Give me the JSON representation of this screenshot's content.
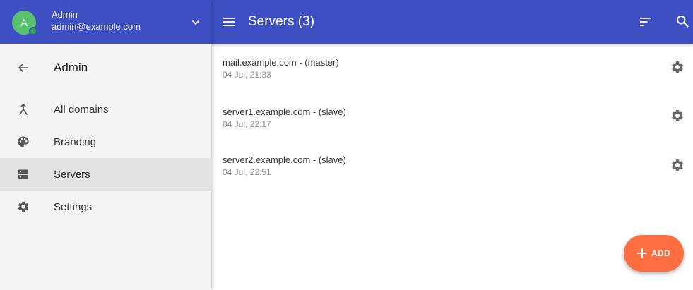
{
  "account": {
    "initial": "A",
    "name": "Admin",
    "email": "admin@example.com",
    "toggle_icon": "chevron-down-icon"
  },
  "nav": {
    "back": {
      "icon": "arrow-back-icon",
      "label": "Admin"
    },
    "items": [
      {
        "icon": "merge-icon",
        "label": "All domains",
        "active": false
      },
      {
        "icon": "palette-icon",
        "label": "Branding",
        "active": false
      },
      {
        "icon": "dns-icon",
        "label": "Servers",
        "active": true
      },
      {
        "icon": "gear-icon",
        "label": "Settings",
        "active": false
      }
    ]
  },
  "topbar": {
    "title": "Servers (3)",
    "menu_icon": "menu-icon",
    "sort_icon": "sort-icon",
    "search_icon": "search-icon"
  },
  "servers": [
    {
      "name": "mail.example.com - (master)",
      "date": "04 Jul, 21:33"
    },
    {
      "name": "server1.example.com - (slave)",
      "date": "04 Jul, 22:17"
    },
    {
      "name": "server2.example.com - (slave)",
      "date": "04 Jul, 22:51"
    }
  ],
  "fab": {
    "label": "ADD",
    "icon": "plus-icon"
  },
  "colors": {
    "primary": "#3e4fc4",
    "accent": "#ff6e40",
    "avatar": "#58c16f",
    "drawer_bg": "#f5f5f5",
    "active_row": "#e3e3e3"
  }
}
